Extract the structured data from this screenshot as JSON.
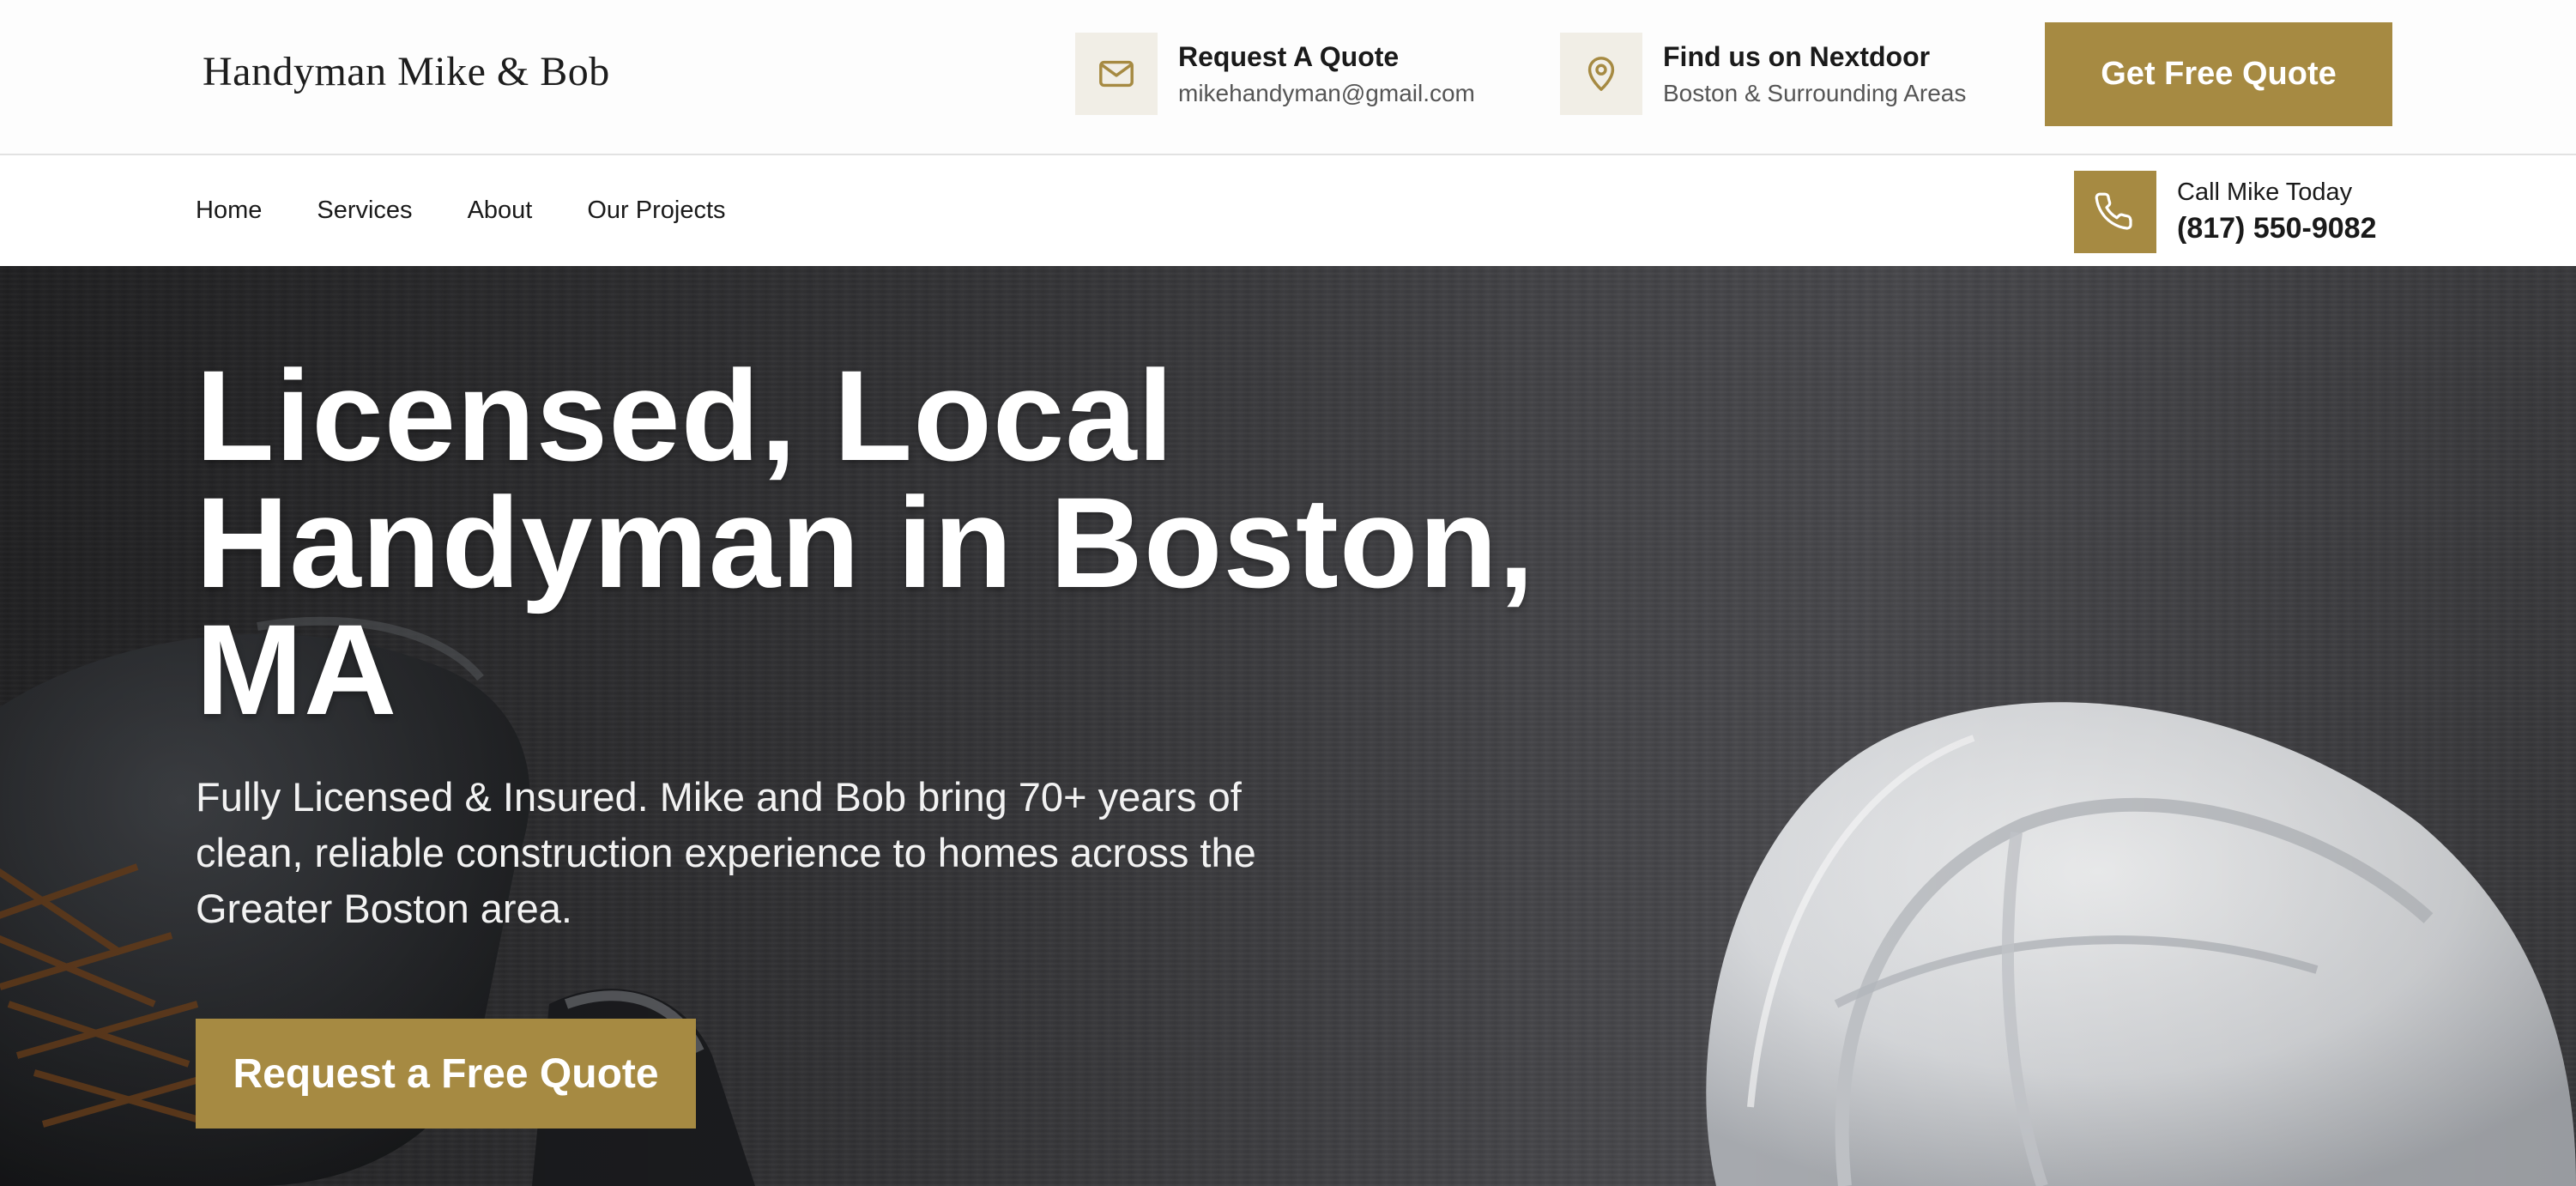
{
  "header": {
    "logo_text": "Handyman Mike & Bob",
    "quote_info": {
      "icon": "mail-icon",
      "title": "Request A Quote",
      "subtitle": "mikehandyman@gmail.com"
    },
    "location_info": {
      "icon": "map-pin-icon",
      "title": "Find us on Nextdoor",
      "subtitle": "Boston & Surrounding Areas"
    },
    "cta_label": "Get Free Quote"
  },
  "nav": {
    "items": [
      {
        "label": "Home"
      },
      {
        "label": "Services"
      },
      {
        "label": "About"
      },
      {
        "label": "Our Projects"
      }
    ],
    "call": {
      "icon": "phone-icon",
      "label": "Call Mike Today",
      "phone": "(817) 550-9082"
    }
  },
  "hero": {
    "title": "Licensed, Local Handyman in Boston, MA",
    "description": "Fully Licensed & Insured. Mike and Bob bring 70+ years of clean, reliable construction experience to homes across the Greater Boston area.",
    "cta_label": "Request a Free Quote"
  },
  "colors": {
    "accent": "#a68a42",
    "icon_bg": "#f1eee6",
    "text_dark": "#1a1a1a",
    "hero_bg": "#3a3a3d"
  }
}
